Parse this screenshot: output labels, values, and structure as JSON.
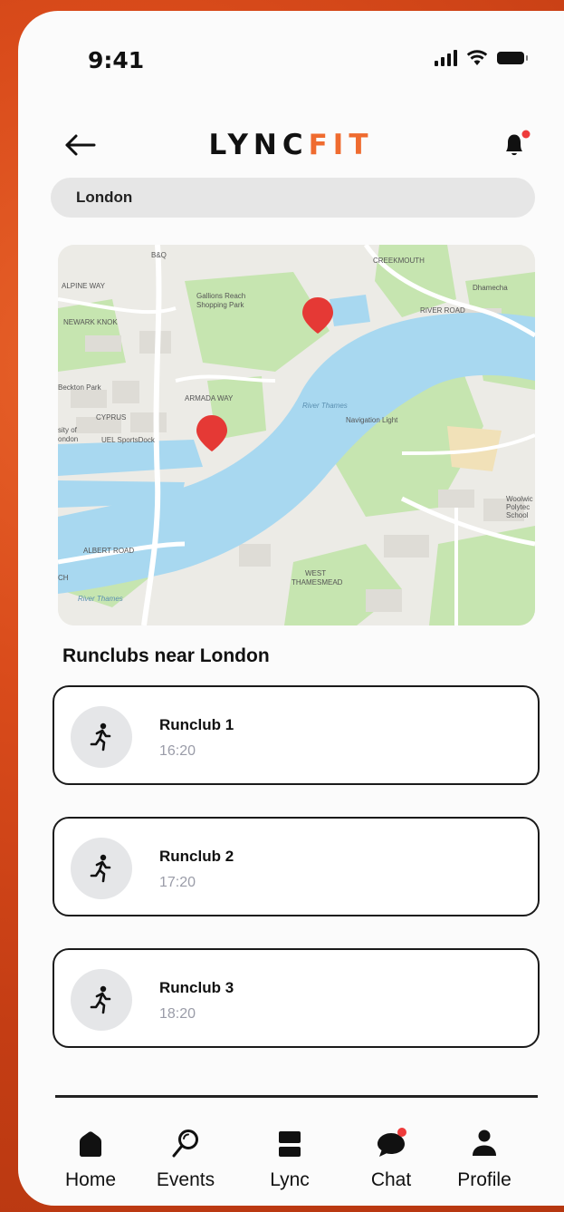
{
  "status_bar": {
    "time": "9:41"
  },
  "header": {
    "logo_main": "LYNC",
    "logo_accent": "FIT",
    "back_icon": "arrow-left-icon",
    "notification_icon": "bell-icon",
    "notification_dot_color": "#ee3b3b"
  },
  "search": {
    "value": "London"
  },
  "map": {
    "labels": {
      "creekmouth": "CREEKMOUTH",
      "bq": "B&Q",
      "alpine_way": "ALPINE WAY",
      "gallions": "Gallions Reach",
      "shopping_park": "Shopping Park",
      "dhamecha": "Dhamecha",
      "river_road": "RIVER ROAD",
      "newark_knok": "NEWARK KNOK",
      "beckton_park": "Beckton Park",
      "armada_way": "ARMADA WAY",
      "river_thames_1": "River Thames",
      "navigation_light": "Navigation Light",
      "cyprus": "CYPRUS",
      "uni_london_1": "sity of",
      "uni_london_2": "ondon",
      "uel_sportsdock": "UEL SportsDock",
      "woolwich_1": "Woolwic",
      "woolwich_2": "Polytec",
      "woolwich_3": "School",
      "albert_road": "ALBERT ROAD",
      "west_thamesmead_1": "WEST",
      "west_thamesmead_2": "THAMESMEAD",
      "river_thames_2": "River Thames",
      "ch": "CH"
    },
    "accent_color": "#e53935",
    "water_color": "#a8d8f0",
    "park_color": "#bfe2a6"
  },
  "section": {
    "title": "Runclubs near London"
  },
  "runclubs": [
    {
      "name": "Runclub 1",
      "time": "16:20",
      "icon": "running-person-icon"
    },
    {
      "name": "Runclub 2",
      "time": "17:20",
      "icon": "running-person-icon"
    },
    {
      "name": "Runclub 3",
      "time": "18:20",
      "icon": "running-person-icon"
    }
  ],
  "tabs": [
    {
      "label": "Home",
      "icon": "home-icon"
    },
    {
      "label": "Events",
      "icon": "search-icon"
    },
    {
      "label": "Lync",
      "icon": "stack-icon"
    },
    {
      "label": "Chat",
      "icon": "chat-bubble-icon"
    },
    {
      "label": "Profile",
      "icon": "person-icon"
    }
  ]
}
